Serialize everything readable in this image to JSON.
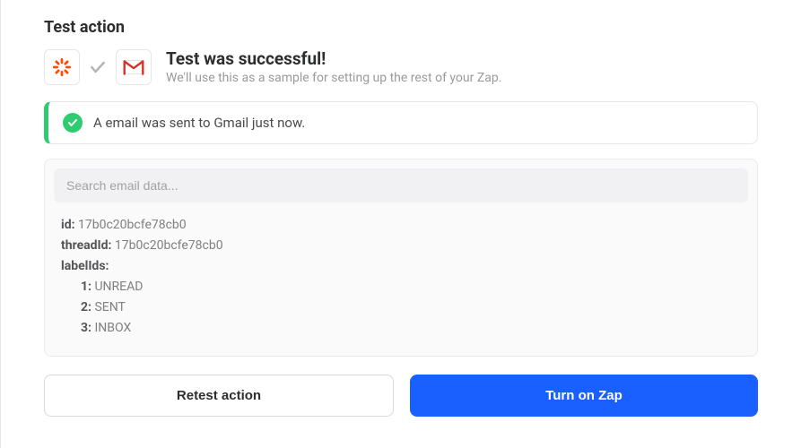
{
  "title": "Test action",
  "header": {
    "heading": "Test was successful!",
    "subtext": "We'll use this as a sample for setting up the rest of your Zap."
  },
  "alert": {
    "message": "A email was sent to Gmail just now."
  },
  "search": {
    "placeholder": "Search email data..."
  },
  "data": {
    "id_label": "id:",
    "id_value": "17b0c20bcfe78cb0",
    "threadId_label": "threadId:",
    "threadId_value": "17b0c20bcfe78cb0",
    "labelIds_label": "labelIds:",
    "labelIds": [
      {
        "key": "1:",
        "value": "UNREAD"
      },
      {
        "key": "2:",
        "value": "SENT"
      },
      {
        "key": "3:",
        "value": "INBOX"
      }
    ]
  },
  "buttons": {
    "retest": "Retest action",
    "turn_on": "Turn on Zap"
  }
}
